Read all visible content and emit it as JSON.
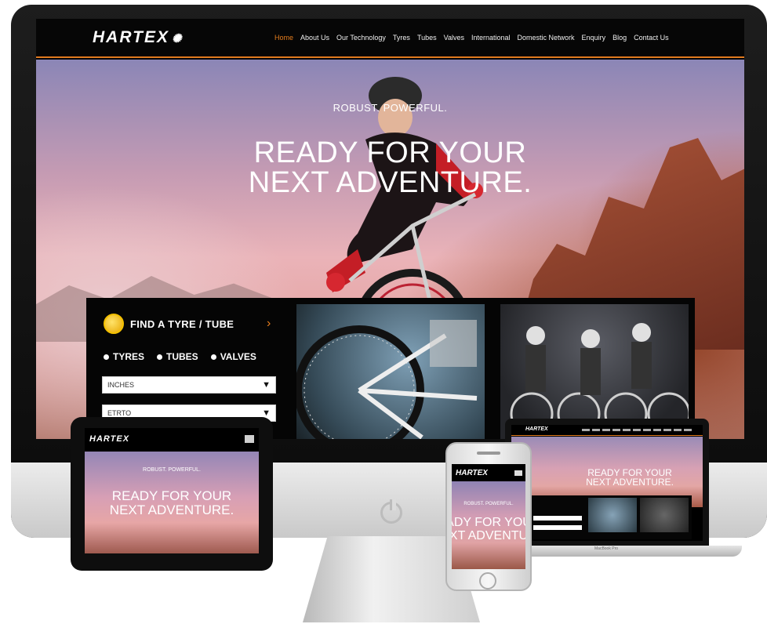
{
  "brand": {
    "name": "HARTEX",
    "accent": "#e57d1d"
  },
  "nav": {
    "items": [
      {
        "label": "Home"
      },
      {
        "label": "About Us"
      },
      {
        "label": "Our Technology"
      },
      {
        "label": "Tyres"
      },
      {
        "label": "Tubes"
      },
      {
        "label": "Valves"
      },
      {
        "label": "International"
      },
      {
        "label": "Domestic Network"
      },
      {
        "label": "Enquiry"
      },
      {
        "label": "Blog"
      },
      {
        "label": "Contact Us"
      }
    ],
    "active": "Home"
  },
  "hero": {
    "tagline": "ROBUST. POWERFUL.",
    "headline_line1": "READY FOR YOUR",
    "headline_line2": "NEXT ADVENTURE."
  },
  "finder": {
    "title": "FIND A TYRE / TUBE",
    "arrow": "›",
    "options": [
      "TYRES",
      "TUBES",
      "VALVES"
    ],
    "select_inches": "INCHES",
    "select_etrto": "ETRTO"
  },
  "tablet": {
    "logo": "HARTEX",
    "tagline": "ROBUST. POWERFUL.",
    "headline_line1": "READY FOR YOUR",
    "headline_line2": "NEXT ADVENTURE."
  },
  "phone": {
    "logo": "HARTEX",
    "tagline": "ROBUST. POWERFUL.",
    "headline_line1": "ADY FOR YOU",
    "headline_line2": "XT ADVENTU"
  },
  "laptop": {
    "logo": "HARTEX",
    "headline_line1": "READY FOR YOUR",
    "headline_line2": "NEXT ADVENTURE.",
    "base_label": "MacBook Pro"
  },
  "icons": [
    "power-icon",
    "magnifier-icon",
    "chevron-right-icon",
    "dropdown-arrow-icon",
    "hamburger-icon",
    "rider-icon"
  ]
}
